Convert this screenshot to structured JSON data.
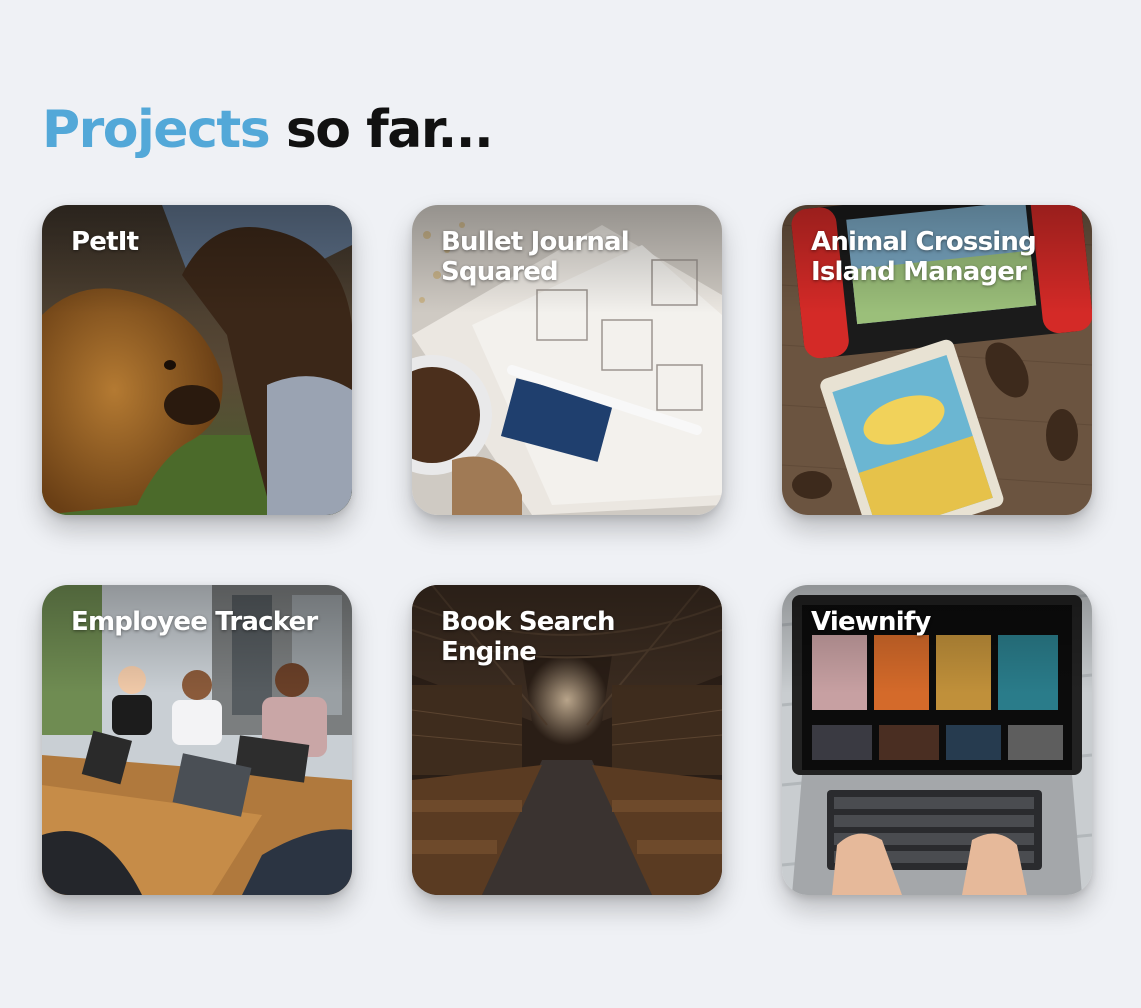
{
  "heading": {
    "accent": "Projects",
    "rest": "so far..."
  },
  "colors": {
    "background": "#eff1f5",
    "accent": "#53a8d8",
    "heading": "#111111",
    "card_title": "#ffffff"
  },
  "projects": [
    {
      "title": "PetIt",
      "image": "dog-with-woman-photo"
    },
    {
      "title": "Bullet Journal Squared",
      "image": "bullet-journal-photo"
    },
    {
      "title": "Animal Crossing Island Manager",
      "image": "nintendo-switch-game-photo"
    },
    {
      "title": "Employee Tracker",
      "image": "office-meeting-photo"
    },
    {
      "title": "Book Search Engine",
      "image": "library-hall-photo"
    },
    {
      "title": "Viewnify",
      "image": "laptop-streaming-photo"
    }
  ]
}
